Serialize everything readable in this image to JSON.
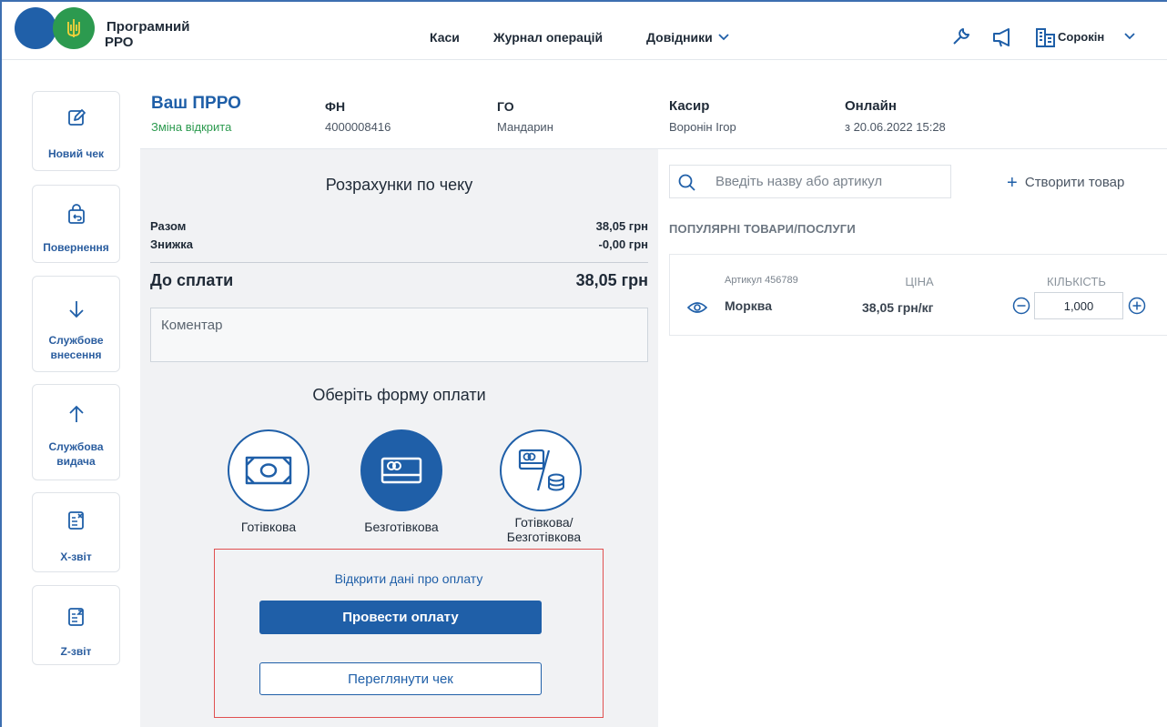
{
  "app": {
    "title_line1": "Програмний",
    "title_line2": "РРО"
  },
  "nav": {
    "cash": "Каси",
    "journal": "Журнал операцій",
    "refs": "Довідники"
  },
  "header": {
    "user": "Сорокін"
  },
  "sidebar": {
    "items": [
      {
        "label": "Новий чек",
        "icon": "edit-icon"
      },
      {
        "label": "Повернення",
        "icon": "return-bag-icon"
      },
      {
        "label": "Службове внесення",
        "line1": "Службове",
        "line2": "внесення",
        "icon": "arrow-down-icon"
      },
      {
        "label": "Службова видача",
        "line1": "Службова",
        "line2": "видача",
        "icon": "arrow-up-icon"
      },
      {
        "label": "X-звіт",
        "icon": "x-report-icon"
      },
      {
        "label": "Z-звіт",
        "icon": "z-report-icon"
      }
    ]
  },
  "info": {
    "prro_title": "Ваш ПРРО",
    "prro_status": "Зміна відкрита",
    "fn_label": "ФН",
    "fn_value": "4000008416",
    "go_label": "ГО",
    "go_value": "Мандарин",
    "cashier_label": "Касир",
    "cashier_value": "Воронін Ігор",
    "online_label": "Онлайн",
    "online_value": "з 20.06.2022 15:28"
  },
  "receipt": {
    "title": "Розрахунки по чеку",
    "total_label": "Разом",
    "total_value": "38,05 грн",
    "discount_label": "Знижка",
    "discount_value": "-0,00 грн",
    "due_label": "До сплати",
    "due_value": "38,05 грн",
    "comment_placeholder": "Коментар",
    "payment_title": "Оберіть форму оплати",
    "pay_cash": "Готівкова",
    "pay_card": "Безготівкова",
    "pay_mixed_1": "Готівкова/",
    "pay_mixed_2": "Безготівкова",
    "open_payment_data": "Відкрити дані про оплату",
    "pay_button": "Провести оплату",
    "view_receipt_button": "Переглянути чек"
  },
  "products": {
    "search_placeholder": "Введіть назву або артикул",
    "create_product": "Створити товар",
    "section_title": "ПОПУЛЯРНІ ТОВАРИ/ПОСЛУГИ",
    "price_header": "ЦІНА",
    "qty_header": "КІЛЬКІСТЬ",
    "items": [
      {
        "article": "Артикул 456789",
        "name": "Морква",
        "price": "38,05 грн/кг",
        "qty": "1,000"
      }
    ]
  },
  "colors": {
    "brand_blue": "#1f5fa8",
    "brand_green": "#2c9a4f",
    "status_green": "#2c9a4f",
    "highlight_red": "#e05050"
  }
}
